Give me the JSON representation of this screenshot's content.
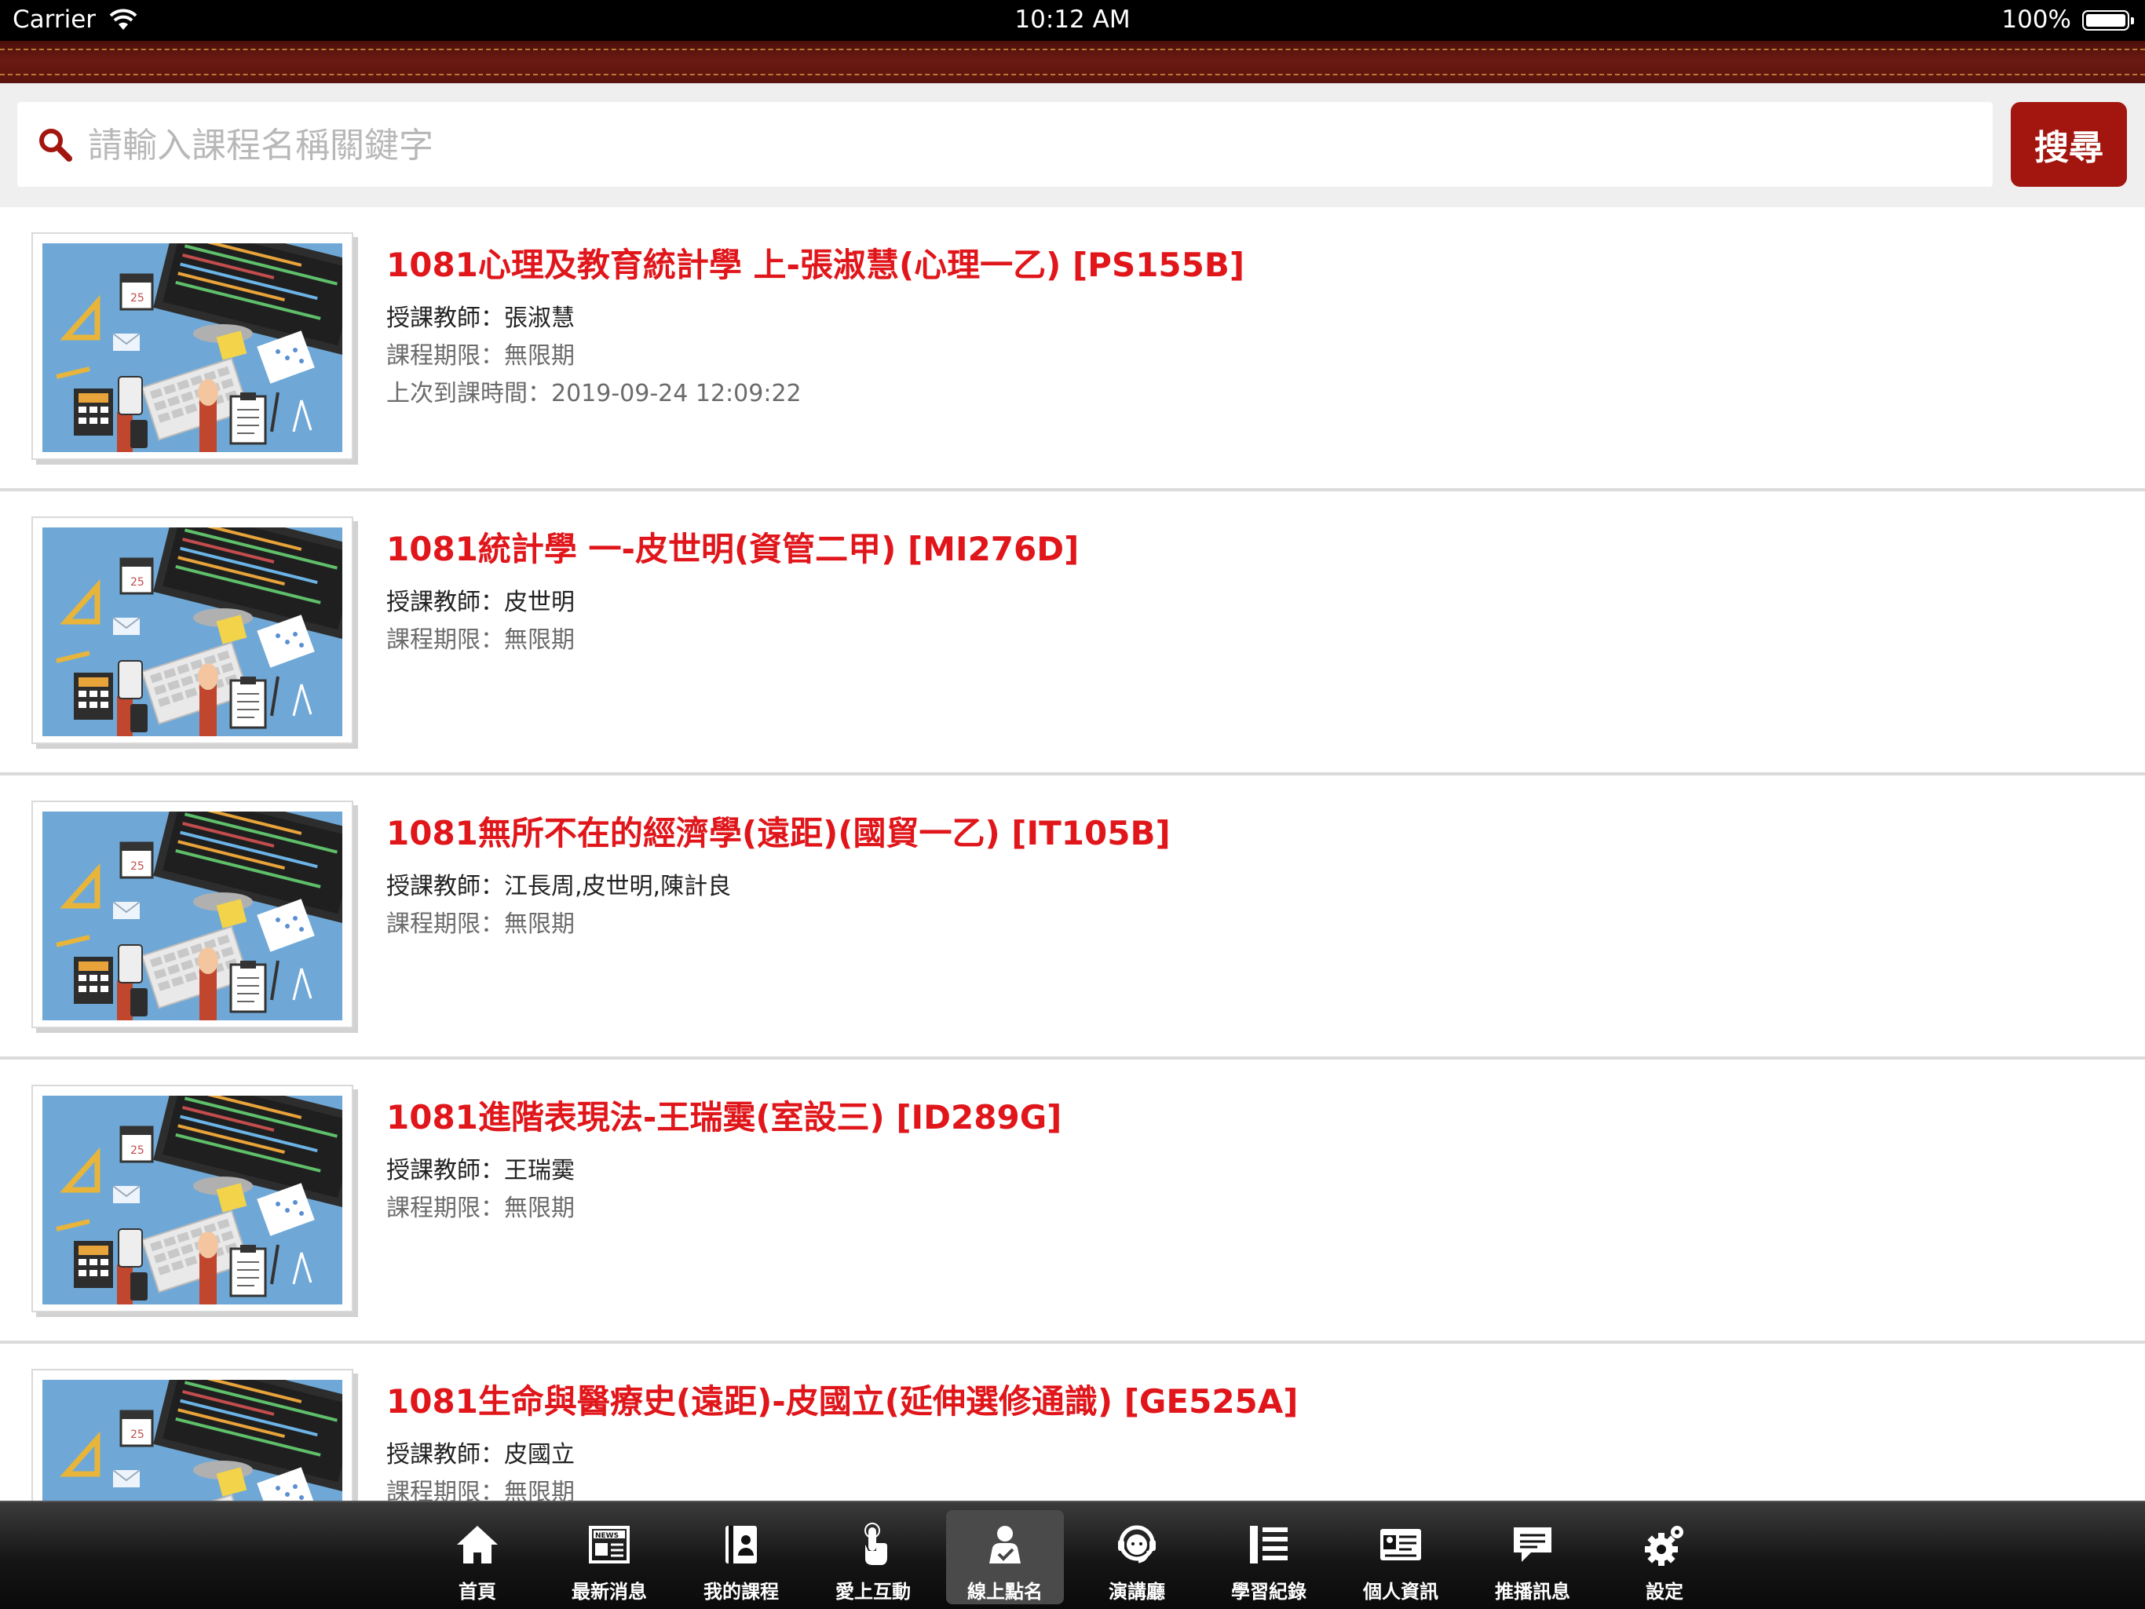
{
  "status_bar": {
    "carrier": "Carrier",
    "time": "10:12 AM",
    "battery": "100%",
    "battery_level": 1.0
  },
  "search": {
    "placeholder": "請輸入課程名稱關鍵字",
    "value": "",
    "button_label": "搜尋",
    "icon": "search-icon"
  },
  "courses": [
    {
      "title": "1081心理及教育統計學 上-張淑慧(心理一乙) [PS155B]",
      "teacher_label": "授課教師：",
      "teacher": "張淑慧",
      "period_label": "課程期限：",
      "period": "無限期",
      "last_visit_label": "上次到課時間：",
      "last_visit": "2019-09-24 12:09:22"
    },
    {
      "title": "1081統計學 一-皮世明(資管二甲) [MI276D]",
      "teacher_label": "授課教師：",
      "teacher": "皮世明",
      "period_label": "課程期限：",
      "period": "無限期"
    },
    {
      "title": "1081無所不在的經濟學(遠距)(國貿一乙) [IT105B]",
      "teacher_label": "授課教師：",
      "teacher": "江長周,皮世明,陳計良",
      "period_label": "課程期限：",
      "period": "無限期"
    },
    {
      "title": "1081進階表現法-王瑞霙(室設三) [ID289G]",
      "teacher_label": "授課教師：",
      "teacher": "王瑞霙",
      "period_label": "課程期限：",
      "period": "無限期"
    },
    {
      "title": "1081生命與醫療史(遠距)-皮國立(延伸選修通識) [GE525A]",
      "teacher_label": "授課教師：",
      "teacher": "皮國立",
      "period_label": "課程期限：",
      "period": "無限期"
    }
  ],
  "tabs": [
    {
      "label": "首頁",
      "icon": "home-icon"
    },
    {
      "label": "最新消息",
      "icon": "news-icon"
    },
    {
      "label": "我的課程",
      "icon": "book-icon"
    },
    {
      "label": "愛上互動",
      "icon": "touch-icon"
    },
    {
      "label": "線上點名",
      "icon": "attendance-icon",
      "active": true
    },
    {
      "label": "演講廳",
      "icon": "headset-icon"
    },
    {
      "label": "學習紀錄",
      "icon": "list-icon"
    },
    {
      "label": "個人資訊",
      "icon": "id-card-icon"
    },
    {
      "label": "推播訊息",
      "icon": "message-icon"
    },
    {
      "label": "設定",
      "icon": "gear-icon"
    }
  ],
  "colors": {
    "title_red": "#e0161b",
    "button_red": "#a3160f",
    "leather": "#6b1a12",
    "tabbar": "#151515"
  }
}
